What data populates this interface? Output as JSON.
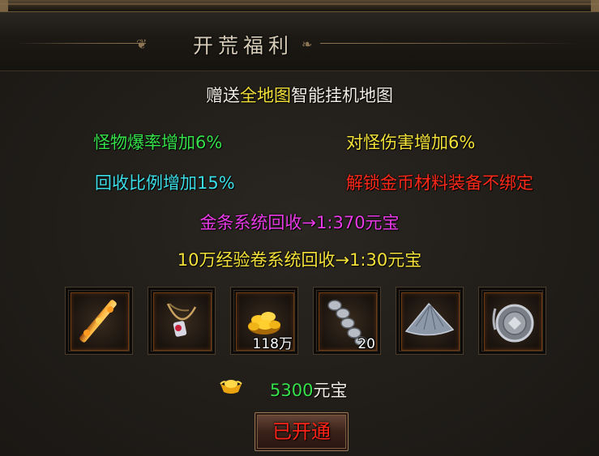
{
  "header": {
    "title": "开荒福利"
  },
  "intro": {
    "prefix": "赠送",
    "highlight": "全地图",
    "suffix": "智能挂机地图"
  },
  "bonuses": [
    {
      "text": "怪物爆率增加6%",
      "color": "#36e04a"
    },
    {
      "text": "对怪伤害增加6%",
      "color": "#f4e23a"
    },
    {
      "text": "回收比例增加15%",
      "color": "#3cdfe8"
    },
    {
      "text": "解锁金币材料装备不绑定",
      "color": "#ff2a1a"
    }
  ],
  "recycle": [
    {
      "text": "金条系统回收→1:370元宝",
      "color": "#e83be6"
    },
    {
      "text": "10万经验卷系统回收→1:30元宝",
      "color": "#f4e23a"
    }
  ],
  "items": [
    {
      "icon": "golden-rod-icon",
      "quantity": ""
    },
    {
      "icon": "gem-necklace-icon",
      "quantity": ""
    },
    {
      "icon": "gold-coins-icon",
      "quantity": "118万"
    },
    {
      "icon": "bone-chain-icon",
      "quantity": "20"
    },
    {
      "icon": "straw-hat-icon",
      "quantity": ""
    },
    {
      "icon": "medal-icon",
      "quantity": ""
    }
  ],
  "price": {
    "amount": "5300",
    "unit": "元宝",
    "icon": "gold-ingot-icon"
  },
  "action": {
    "label": "已开通"
  }
}
